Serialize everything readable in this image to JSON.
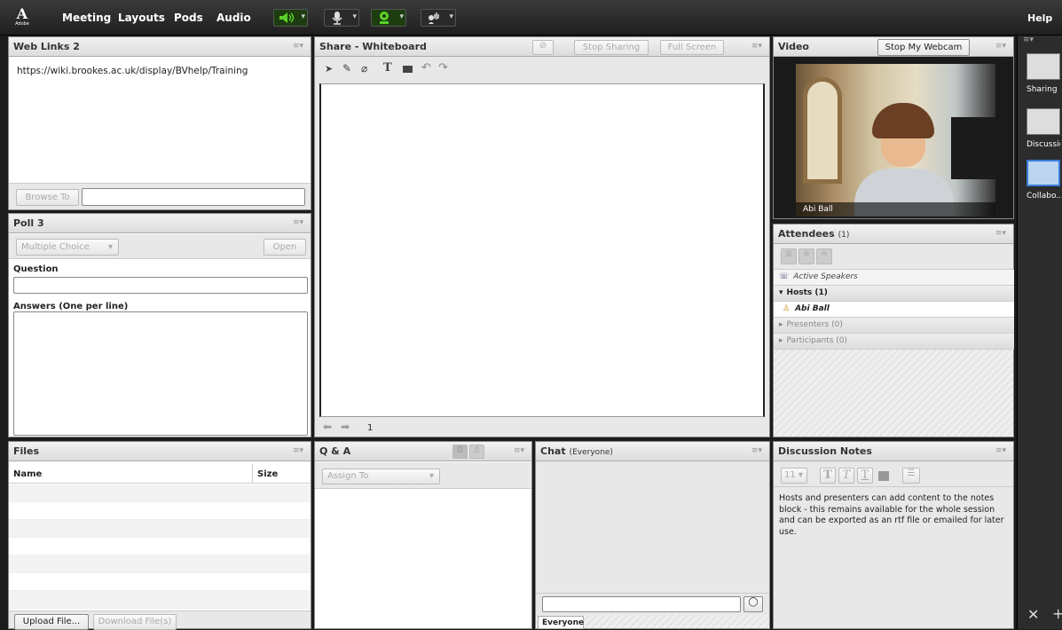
{
  "topbar": {
    "logo_mark": "A",
    "logo_text": "Adobe",
    "menu": [
      "Meeting",
      "Layouts",
      "Pods",
      "Audio"
    ],
    "help": "Help",
    "accent": "#5ad12a"
  },
  "weblinks": {
    "title": "Web Links 2",
    "url": "https://wiki.brookes.ac.uk/display/BVhelp/Training",
    "browse_button": "Browse To"
  },
  "poll": {
    "title": "Poll 3",
    "type": "Multiple Choice",
    "open_button": "Open",
    "question_label": "Question",
    "answers_label": "Answers (One per line)"
  },
  "whiteboard": {
    "title": "Share - Whiteboard",
    "stop_sharing": "Stop Sharing",
    "full_screen": "Full Screen",
    "page": "1"
  },
  "video": {
    "title": "Video",
    "stop_webcam": "Stop My Webcam",
    "name_label": "Abi Ball"
  },
  "attendees": {
    "title": "Attendees",
    "count": "(1)",
    "active_speakers": "Active Speakers",
    "hosts": "Hosts (1)",
    "host_name": "Abi Ball",
    "presenters": "Presenters (0)",
    "participants": "Participants (0)"
  },
  "files": {
    "title": "Files",
    "col_name": "Name",
    "col_size": "Size",
    "upload": "Upload File...",
    "download": "Download File(s)"
  },
  "qa": {
    "title": "Q & A",
    "assign": "Assign To"
  },
  "chat": {
    "title": "Chat",
    "scope": "(Everyone)",
    "tab": "Everyone"
  },
  "notes": {
    "title": "Discussion Notes",
    "font_size": "11",
    "content": "Hosts and presenters can add content to the notes block - this remains available for the whole session and can be exported as an rtf file or emailed for later use."
  },
  "layouts": [
    {
      "label": "Sharing"
    },
    {
      "label": "Discussio"
    },
    {
      "label": "Collabo..."
    }
  ]
}
